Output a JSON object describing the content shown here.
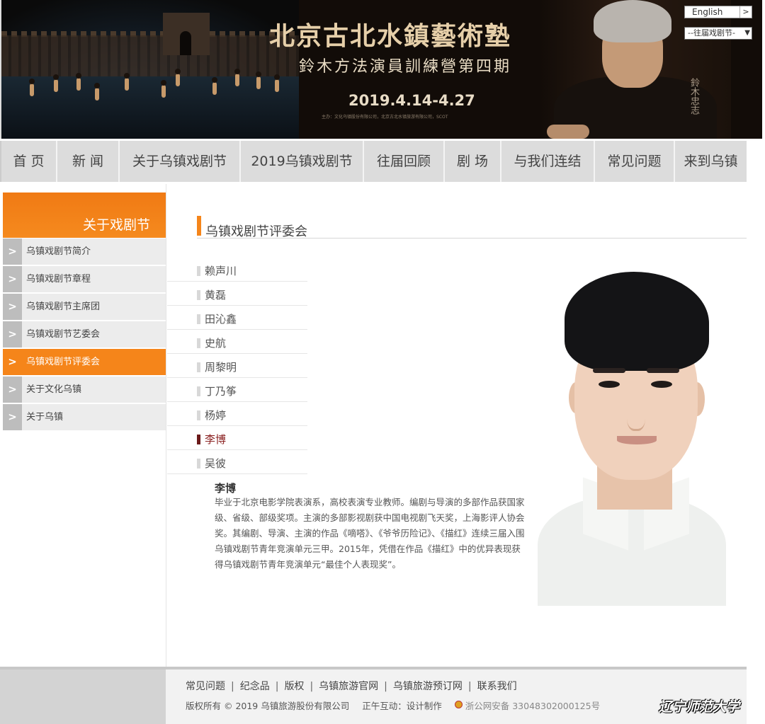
{
  "banner": {
    "title": "北京古北水鎮藝術塾",
    "subtitle": "鈴木方法演員訓練營第四期",
    "date": "2019.4.14-4.27",
    "organizers": "主办：文化乌镇股份有限公司，北京古北水镇旅游有限公司，SCOT",
    "signature": "鈴木忠志"
  },
  "language_toggle": {
    "label": "English",
    "arrow": ">"
  },
  "year_select": {
    "value": "--往届戏剧节-",
    "caret": "▼"
  },
  "nav": [
    "首 页",
    "新 闻",
    "关于乌镇戏剧节",
    "2019乌镇戏剧节",
    "往届回顾",
    "剧 场",
    "与我们连结",
    "常见问题",
    "来到乌镇"
  ],
  "sidebar": {
    "heading": "关于戏剧节",
    "items": [
      {
        "label": "乌镇戏剧节简介",
        "active": false
      },
      {
        "label": "乌镇戏剧节章程",
        "active": false
      },
      {
        "label": "乌镇戏剧节主席团",
        "active": false
      },
      {
        "label": "乌镇戏剧节艺委会",
        "active": false
      },
      {
        "label": "乌镇戏剧节评委会",
        "active": true
      },
      {
        "label": "关于文化乌镇",
        "active": false
      },
      {
        "label": "关于乌镇",
        "active": false
      }
    ],
    "arrow": ">"
  },
  "section": {
    "title": "乌镇戏剧节评委会"
  },
  "judges": [
    {
      "name": "赖声川",
      "selected": false
    },
    {
      "name": "黄磊",
      "selected": false
    },
    {
      "name": "田沁鑫",
      "selected": false
    },
    {
      "name": "史航",
      "selected": false
    },
    {
      "name": "周黎明",
      "selected": false
    },
    {
      "name": "丁乃筝",
      "selected": false
    },
    {
      "name": "杨婷",
      "selected": false
    },
    {
      "name": "李博",
      "selected": true
    },
    {
      "name": "吴彼",
      "selected": false
    }
  ],
  "bio": {
    "name": "李博",
    "text": "毕业于北京电影学院表演系，高校表演专业教师。编剧与导演的多部作品获国家级、省级、部级奖项。主演的多部影视剧获中国电视剧飞天奖，上海影评人协会奖。其编剧、导演、主演的作品《嘀嗒》、《爷爷历险记》、《描红》连续三届入围乌镇戏剧节青年竞演单元三甲。2015年，凭借在作品《描红》中的优异表现获得乌镇戏剧节青年竞演单元“最佳个人表现奖”。"
  },
  "footer": {
    "links": [
      "常见问题",
      "纪念品",
      "版权",
      "乌镇旅游官网",
      "乌镇旅游预订网",
      "联系我们"
    ],
    "copyright": "版权所有 © 2019 乌镇旅游股份有限公司",
    "credit": "正午互动：设计制作",
    "police": "浙公网安备 33048302000125号"
  },
  "watermark": "辽宁师范大学",
  "colors": {
    "accent": "#f5851a",
    "selected_name": "#8a2020"
  }
}
